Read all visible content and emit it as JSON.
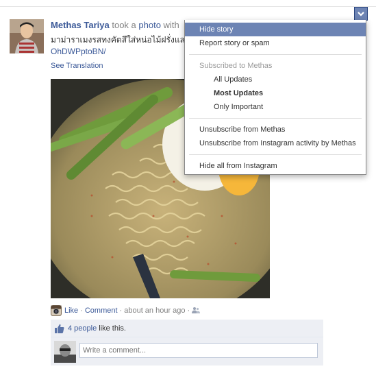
{
  "story": {
    "actor_name": "Methas Tariya",
    "verb_text": " took a ",
    "photo_link": "photo",
    "with_text": " with",
    "message_line1": "มาม่าราเมงรสทงคัตสึใส่หน่อไม้ฝรั่งแล",
    "message_line2": "OhDWPptoBN/",
    "see_translation": "See Translation"
  },
  "actions": {
    "like": "Like",
    "comment": "Comment",
    "timestamp": "about an hour ago",
    "separator": "·"
  },
  "likes": {
    "count": "4 people",
    "tail": "like this."
  },
  "comment_box": {
    "placeholder": "Write a comment..."
  },
  "menu": {
    "hide_story": "Hide story",
    "report": "Report story or spam",
    "subscribed_header": "Subscribed to Methas",
    "all_updates": "All Updates",
    "most_updates": "Most Updates",
    "only_important": "Only Important",
    "unsubscribe": "Unsubscribe from Methas",
    "unsubscribe_instagram": "Unsubscribe from Instagram activity by Methas",
    "hide_all_instagram": "Hide all from Instagram"
  },
  "colors": {
    "link_blue": "#3b5998",
    "menu_highlight": "#6d84b4",
    "ufi_bg": "#edeff4"
  },
  "icons": [
    "chevron-down-icon",
    "like-thumb-icon",
    "instagram-icon",
    "privacy-friends-icon"
  ]
}
